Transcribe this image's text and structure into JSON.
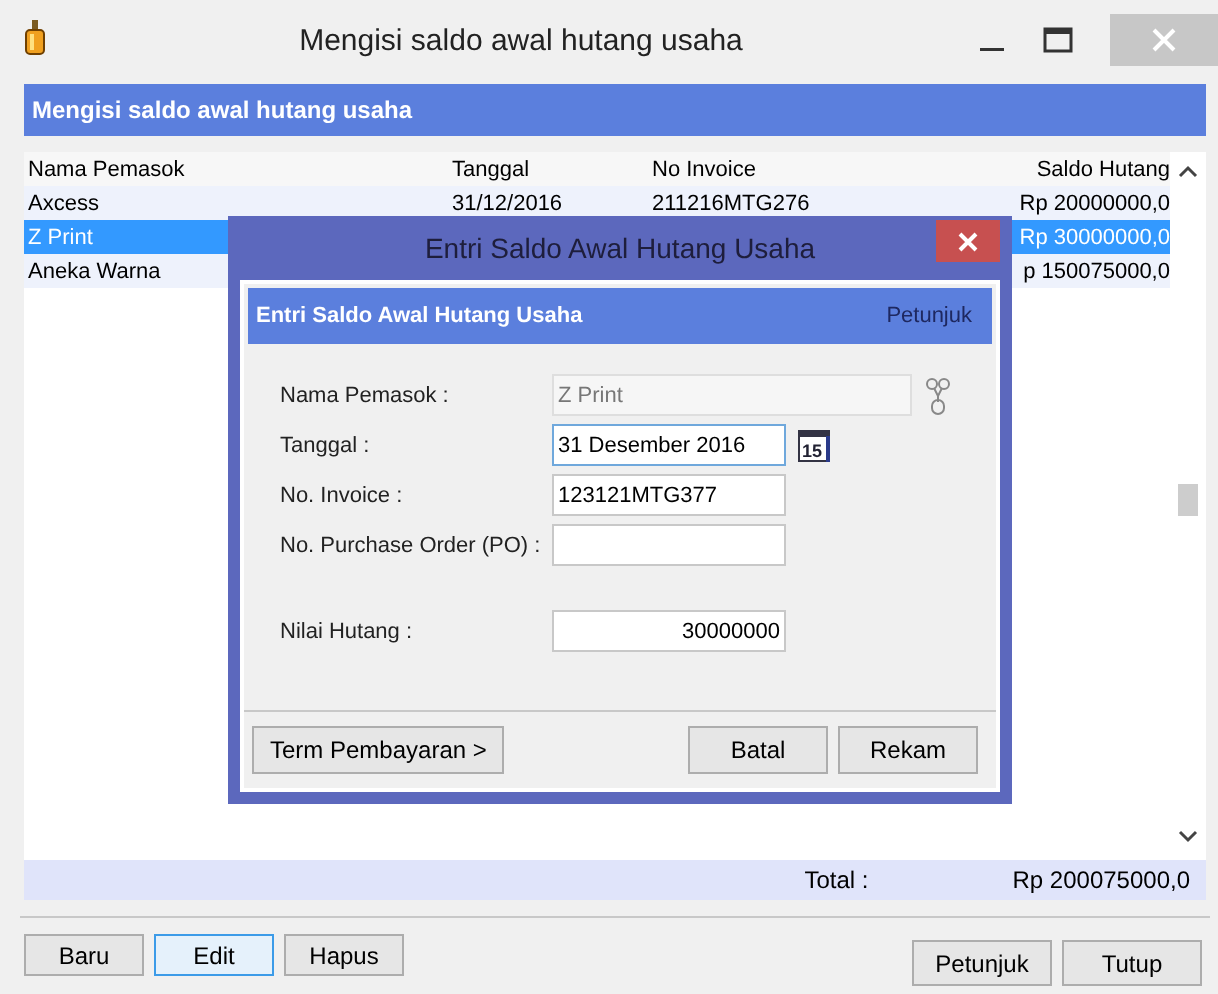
{
  "window": {
    "title": "Mengisi saldo awal hutang usaha"
  },
  "header": {
    "title": "Mengisi saldo awal hutang usaha"
  },
  "table": {
    "columns": [
      "Nama Pemasok",
      "Tanggal",
      "No Invoice",
      "Saldo Hutang"
    ],
    "rows": [
      {
        "cells": [
          "Axcess",
          "31/12/2016",
          "211216MTG276",
          "Rp 20000000,0"
        ],
        "selected": false
      },
      {
        "cells": [
          "Z Print",
          "",
          "",
          "Rp 30000000,0"
        ],
        "selected": true
      },
      {
        "cells": [
          "Aneka Warna",
          "",
          "",
          "p 150075000,0"
        ],
        "selected": false
      }
    ],
    "total_label": "Total :",
    "total_value": "Rp 200075000,0"
  },
  "buttons_left": [
    {
      "label": "Baru",
      "focused": false
    },
    {
      "label": "Edit",
      "focused": true
    },
    {
      "label": "Hapus",
      "focused": false
    }
  ],
  "buttons_right": [
    {
      "label": "Petunjuk",
      "focused": false
    },
    {
      "label": "Tutup",
      "focused": false
    }
  ],
  "dialog": {
    "title": "Entri Saldo Awal Hutang Usaha",
    "header": "Entri Saldo Awal Hutang Usaha",
    "help_link": "Petunjuk",
    "fields": [
      {
        "label": "Nama Pemasok :",
        "value": "Z Print",
        "kind": "picker",
        "disabled": true,
        "focused": false
      },
      {
        "label": "Tanggal :",
        "value": "31 Desember 2016",
        "kind": "date",
        "disabled": false,
        "focused": true,
        "calendar_day": "15"
      },
      {
        "label": "No. Invoice :",
        "value": "123121MTG377",
        "kind": "text",
        "disabled": false,
        "focused": false
      },
      {
        "label": "No. Purchase Order (PO)  :",
        "kind": "text",
        "disabled": false,
        "focused": false
      },
      {
        "label": "Nilai Hutang :",
        "value": "30000000",
        "kind": "amount",
        "disabled": false,
        "focused": false
      }
    ],
    "term_button": "Term Pembayaran >",
    "buttons": [
      "Batal",
      "Rekam"
    ]
  }
}
